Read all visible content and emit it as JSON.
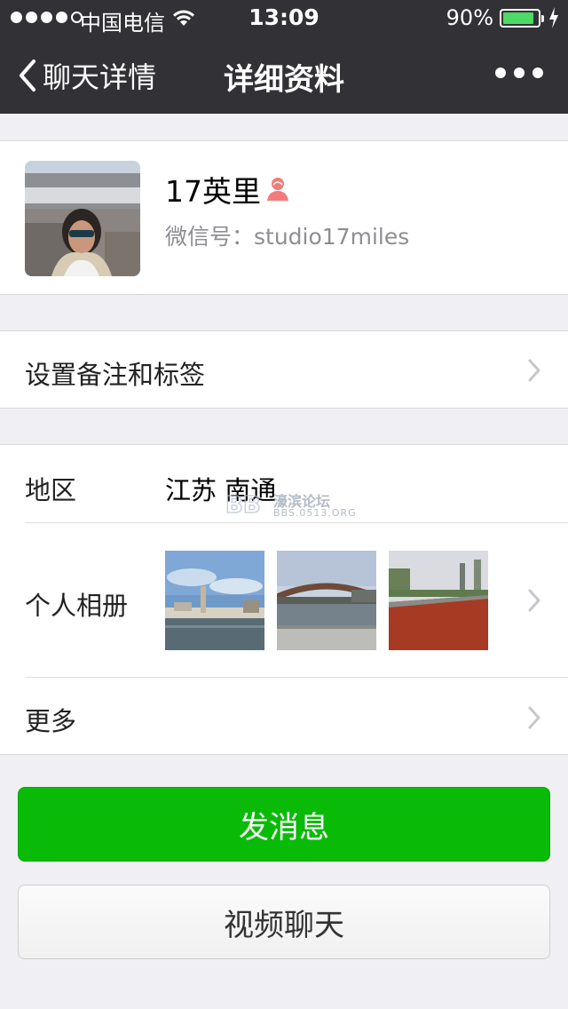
{
  "status_bar": {
    "carrier": "中国电信",
    "time": "13:09",
    "battery": "90%",
    "battery_level": 0.9
  },
  "nav": {
    "back_label": "聊天详情",
    "title": "详细资料",
    "more_icon": "more-dots-icon"
  },
  "profile": {
    "name": "17英里",
    "gender_icon": "female-icon",
    "wechat_id": "微信号：studio17miles"
  },
  "remark_row": {
    "label": "设置备注和标签"
  },
  "region_row": {
    "label": "地区",
    "value": "江苏 南通"
  },
  "album_row": {
    "label": "个人相册"
  },
  "more_row": {
    "label": "更多"
  },
  "watermark": {
    "line1": "濠滨论坛",
    "line2": "BBS.0513.ORG"
  },
  "buttons": {
    "send_message": "发消息",
    "video_chat": "视频聊天"
  },
  "colors": {
    "nav_bg": "#323236",
    "primary_green": "#09bb07",
    "page_bg": "#efeff4",
    "battery_green": "#4cd964"
  }
}
